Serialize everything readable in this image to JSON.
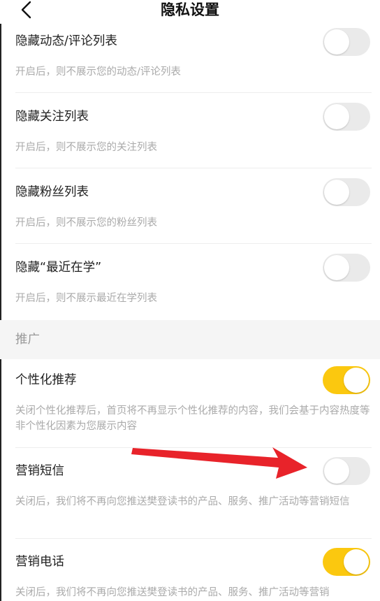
{
  "header": {
    "title": "隐私设置"
  },
  "section_privacy": {
    "items": [
      {
        "label": "隐藏动态/评论列表",
        "desc": "开启后，则不展示您的动态/评论列表",
        "enabled": false
      },
      {
        "label": "隐藏关注列表",
        "desc": "开启后，则不展示您的关注列表",
        "enabled": false
      },
      {
        "label": "隐藏粉丝列表",
        "desc": "开启后，则不展示您的粉丝列表",
        "enabled": false
      },
      {
        "label": "隐藏“最近在学”",
        "desc": "开启后，则不展示最近在学列表",
        "enabled": false
      }
    ]
  },
  "section_promo": {
    "label": "推广",
    "items": [
      {
        "label": "个性化推荐",
        "desc": "关闭个性化推荐后，首页将不再显示个性化推荐的内容，我们会基于内容热度等非个性化因素为您展示内容",
        "enabled": true
      },
      {
        "label": "营销短信",
        "desc": "关闭后，我们将不再向您推送樊登读书的产品、服务、推广活动等营销短信",
        "enabled": false
      },
      {
        "label": "营销电话",
        "desc": "关闭后，我们将不再向您推送樊登读书的产品、服务、推广活动等营销",
        "enabled": true
      }
    ]
  },
  "colors": {
    "toggle_on": "#fbc80f",
    "toggle_off": "#eaeaea",
    "annotation_arrow": "#e8232a"
  }
}
